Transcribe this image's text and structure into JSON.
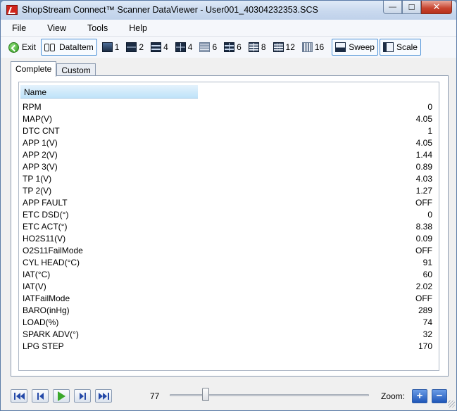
{
  "window": {
    "title": "ShopStream Connect™ Scanner DataViewer - User001_40304232353.SCS",
    "minimize_glyph": "—",
    "maximize_glyph": "☐",
    "close_glyph": "✕"
  },
  "menu": [
    "File",
    "View",
    "Tools",
    "Help"
  ],
  "toolbar": {
    "exit_label": "Exit",
    "dataitem_label": "DataItem",
    "layouts": [
      "1",
      "2",
      "4",
      "4",
      "6",
      "6",
      "8",
      "12",
      "16"
    ],
    "sweep_label": "Sweep",
    "scale_label": "Scale"
  },
  "tabs": [
    "Complete",
    "Custom"
  ],
  "active_tab": "Complete",
  "grid": {
    "header": "Name",
    "rows": [
      {
        "name": "RPM",
        "value": "0"
      },
      {
        "name": "MAP(V)",
        "value": "4.05"
      },
      {
        "name": "DTC CNT",
        "value": "1"
      },
      {
        "name": "APP 1(V)",
        "value": "4.05"
      },
      {
        "name": "APP 2(V)",
        "value": "1.44"
      },
      {
        "name": "APP 3(V)",
        "value": "0.89"
      },
      {
        "name": "TP 1(V)",
        "value": "4.03"
      },
      {
        "name": "TP 2(V)",
        "value": "1.27"
      },
      {
        "name": "APP FAULT",
        "value": "OFF"
      },
      {
        "name": "ETC DSD(°)",
        "value": "0"
      },
      {
        "name": "ETC ACT(°)",
        "value": "8.38"
      },
      {
        "name": "HO2S11(V)",
        "value": "0.09"
      },
      {
        "name": "O2S11FailMode",
        "value": "OFF"
      },
      {
        "name": "CYL HEAD(°C)",
        "value": "91"
      },
      {
        "name": "IAT(°C)",
        "value": "60"
      },
      {
        "name": "IAT(V)",
        "value": "2.02"
      },
      {
        "name": "IATFailMode",
        "value": "OFF"
      },
      {
        "name": "BARO(inHg)",
        "value": "289"
      },
      {
        "name": "LOAD(%)",
        "value": "74"
      },
      {
        "name": "SPARK ADV(°)",
        "value": "32"
      },
      {
        "name": "LPG STEP",
        "value": "170"
      }
    ]
  },
  "playback": {
    "frame": "77",
    "zoom_label": "Zoom:",
    "zoom_in": "+",
    "zoom_out": "−",
    "slider_position": 0.18
  },
  "colors": {
    "header_bg": "#bfe3f9",
    "accent": "#4b91d6",
    "play_green": "#3aa82a"
  }
}
